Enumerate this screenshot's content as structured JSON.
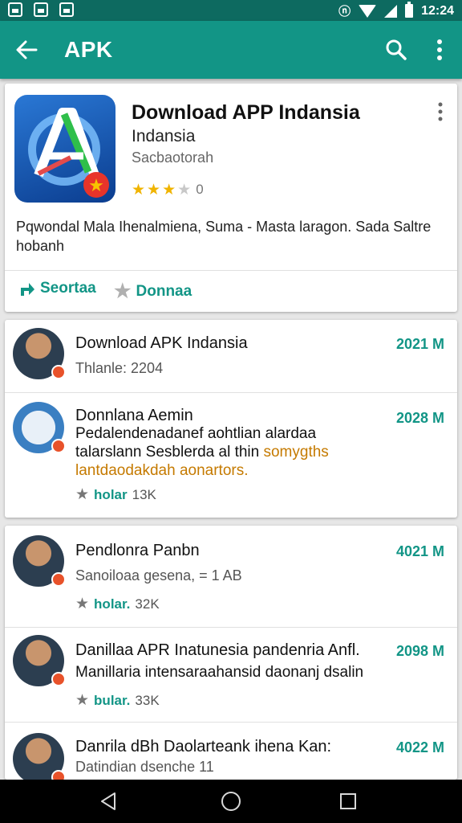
{
  "status_bar": {
    "time": "12:24",
    "icons": [
      "image-icon",
      "photo-icon",
      "shop-icon",
      "nfc-icon",
      "wifi-icon",
      "signal-icon",
      "battery-icon"
    ]
  },
  "app_bar": {
    "title": "APK",
    "back_icon": "arrow-back-icon",
    "search_icon": "search-icon",
    "more_icon": "more-vert-icon"
  },
  "app": {
    "title": "Download APP Indansia",
    "developer": "Indansia",
    "category": "Sacbaotorah",
    "rating_stars": 3,
    "rating_count": "0",
    "description": "Pqwondal Mala Ihenalmiena, Suma - Masta laragon. Sada Saltre hobanh",
    "actions": [
      {
        "label": "Seortaa",
        "icon": "share-icon"
      },
      {
        "label": "Donnaa",
        "icon": "star-icon"
      }
    ]
  },
  "reviews_group1": [
    {
      "title": "Download APK Indansia",
      "subtitle": "Thlanle: 2204",
      "date": "2021 M"
    },
    {
      "title": "Donnlana Aemin",
      "body_start": "Pedalendenadanef aohtlian alardaa talarslann Sesblerda al thin ",
      "body_highlight": "somygths lantdaodakdah aonartors.",
      "likes_label": "holar",
      "likes_count": "13K",
      "date": "2028 M"
    }
  ],
  "reviews_group2": [
    {
      "title": "Pendlonra Panbn",
      "subtitle": "Sanoiloaa gesena, = 1 AB",
      "likes_label": "holar.",
      "likes_count": "32K",
      "date": "4021 M"
    },
    {
      "title": "Danillaa APR Inatunesia pandenria Anfl.",
      "subtitle": "Manillaria intensaraahansid daonanj dsalin",
      "likes_label": "bular.",
      "likes_count": "33K",
      "date": "2098 M"
    },
    {
      "title": "Danrila dBh Daolarteank ihena Kan:",
      "subtitle": "Datindian dsenche 11",
      "date": "4022 M"
    }
  ],
  "colors": {
    "primary": "#129586",
    "status_bar": "#0d6a60",
    "star": "#f0b400",
    "highlight": "#c57a00"
  },
  "nav": {
    "back_icon": "nav-back-icon",
    "home_icon": "nav-home-icon",
    "recents_icon": "nav-recents-icon"
  }
}
